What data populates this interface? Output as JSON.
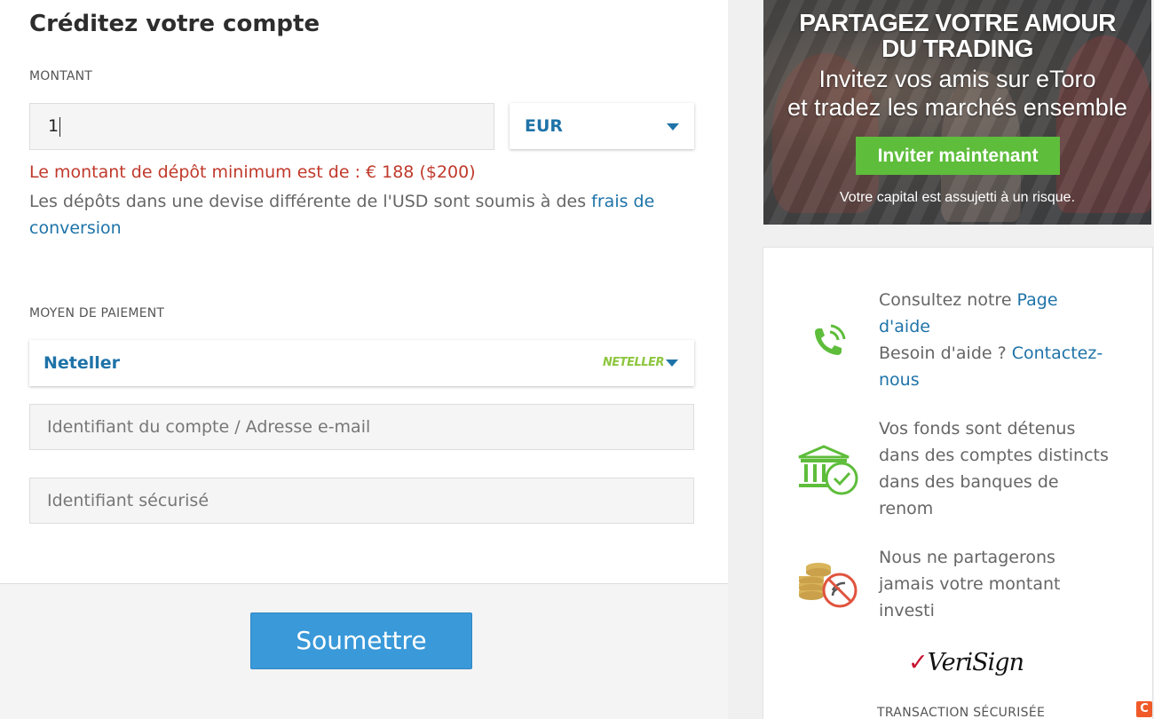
{
  "form": {
    "title": "Créditez votre compte",
    "amount_label": "MONTANT",
    "amount_value": "1",
    "currency": "EUR",
    "error_message": "Le montant de dépôt minimum est de : € 188 ($200)",
    "info_prefix": "Les dépôts dans une devise différente de l'USD sont soumis à des ",
    "info_link": "frais de conversion",
    "payment_label": "MOYEN DE PAIEMENT",
    "payment_method": "Neteller",
    "payment_logo_text": "NETELLER",
    "account_placeholder": "Identifiant du compte / Adresse e-mail",
    "secure_placeholder": "Identifiant sécurisé",
    "submit_label": "Soumettre"
  },
  "banner": {
    "title_line1": "PARTAGEZ VOTRE AMOUR",
    "title_line2": "DU TRADING",
    "sub_line1": "Invitez vos amis sur eToro",
    "sub_line2": "et tradez les marchés ensemble",
    "button_label": "Inviter maintenant",
    "risk_text": "Votre capital est assujetti à un risque."
  },
  "info": {
    "help_prefix": "Consultez notre ",
    "help_link": "Page d'aide",
    "contact_prefix": "Besoin d'aide ? ",
    "contact_link": "Contactez-nous",
    "funds_text": "Vos fonds sont détenus dans des comptes distincts dans des banques de renom",
    "privacy_text": "Nous ne partagerons jamais votre montant investi",
    "verisign_brand": "VeriSign",
    "secure_label": "TRANSACTION SÉCURISÉE"
  },
  "colors": {
    "accent_blue": "#1e73a8",
    "submit_blue": "#3a99d9",
    "error_red": "#c0392b",
    "invite_green": "#5ebd3b",
    "icon_green": "#5ebd3b",
    "icon_red": "#e0533d"
  },
  "icons": [
    "phone-icon",
    "bank-check-icon",
    "coins-no-share-icon",
    "caret-down-icon"
  ]
}
